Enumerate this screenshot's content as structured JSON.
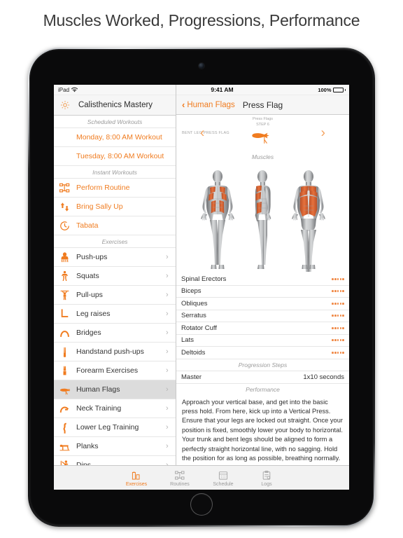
{
  "page": {
    "title": "Muscles Worked, Progressions, Performance"
  },
  "theme": {
    "accent": "#f07c20",
    "muscle_dot": "#f08a48",
    "selected_row_bg": "#dcdcdc"
  },
  "sidebar": {
    "status": {
      "device": "iPad",
      "wifi_icon": "wifi-icon"
    },
    "header": {
      "settings_icon": "gear-icon",
      "title": "Calisthenics Mastery"
    },
    "sections": [
      {
        "title": "Scheduled Workouts",
        "items": [
          {
            "label": "Monday, 8:00 AM Workout",
            "accent": true,
            "icon": null,
            "chevron": false
          },
          {
            "label": "Tuesday, 8:00 AM Workout",
            "accent": true,
            "icon": null,
            "chevron": false
          }
        ]
      },
      {
        "title": "Instant Workouts",
        "items": [
          {
            "label": "Perform Routine",
            "accent": true,
            "icon": "routine-icon",
            "chevron": false
          },
          {
            "label": "Bring Sally Up",
            "accent": true,
            "icon": "updown-arrows-icon",
            "chevron": false
          },
          {
            "label": "Tabata",
            "accent": true,
            "icon": "timer-icon",
            "chevron": false
          }
        ]
      },
      {
        "title": "Exercises",
        "items": [
          {
            "label": "Push-ups",
            "accent": false,
            "icon": "pushup-icon",
            "chevron": true,
            "selected": false
          },
          {
            "label": "Squats",
            "accent": false,
            "icon": "squat-icon",
            "chevron": true,
            "selected": false
          },
          {
            "label": "Pull-ups",
            "accent": false,
            "icon": "pullup-icon",
            "chevron": true,
            "selected": false
          },
          {
            "label": "Leg raises",
            "accent": false,
            "icon": "legraise-icon",
            "chevron": true,
            "selected": false
          },
          {
            "label": "Bridges",
            "accent": false,
            "icon": "bridge-icon",
            "chevron": true,
            "selected": false
          },
          {
            "label": "Handstand push-ups",
            "accent": false,
            "icon": "handstand-icon",
            "chevron": true,
            "selected": false
          },
          {
            "label": "Forearm Exercises",
            "accent": false,
            "icon": "forearm-icon",
            "chevron": true,
            "selected": false
          },
          {
            "label": "Human Flags",
            "accent": false,
            "icon": "humanflag-icon",
            "chevron": true,
            "selected": true
          },
          {
            "label": "Neck Training",
            "accent": false,
            "icon": "neck-icon",
            "chevron": true,
            "selected": false
          },
          {
            "label": "Lower Leg Training",
            "accent": false,
            "icon": "lowerleg-icon",
            "chevron": true,
            "selected": false
          },
          {
            "label": "Planks",
            "accent": false,
            "icon": "plank-icon",
            "chevron": true,
            "selected": false
          },
          {
            "label": "Dips",
            "accent": false,
            "icon": "dips-icon",
            "chevron": true,
            "selected": false
          }
        ]
      }
    ]
  },
  "detail": {
    "status": {
      "time": "9:41 AM",
      "battery_percent": "100%"
    },
    "navbar": {
      "back_label": "Human Flags",
      "title": "Press Flag"
    },
    "stepper": {
      "prev_label": "BENT LEG PRESS FLAG",
      "current_group": "Press Flags",
      "current_step": "STEP 6",
      "prev_arrow": "chevron-left-icon",
      "next_arrow": "chevron-right-icon"
    },
    "muscles_section": {
      "title": "Muscles"
    },
    "figures": [
      {
        "name": "anatomy-front"
      },
      {
        "name": "anatomy-side"
      },
      {
        "name": "anatomy-back"
      }
    ],
    "muscles": [
      {
        "name": "Spinal Erectors",
        "intensity": 5
      },
      {
        "name": "Biceps",
        "intensity": 5
      },
      {
        "name": "Obliques",
        "intensity": 5
      },
      {
        "name": "Serratus",
        "intensity": 5
      },
      {
        "name": "Rotator Cuff",
        "intensity": 5
      },
      {
        "name": "Lats",
        "intensity": 5
      },
      {
        "name": "Deltoids",
        "intensity": 5
      }
    ],
    "progression_section": {
      "title": "Progression Steps"
    },
    "progressions": [
      {
        "label": "Master",
        "value": "1x10 seconds"
      }
    ],
    "performance_section": {
      "title": "Performance"
    },
    "performance_text": "Approach your vertical base, and get into the basic press hold. From here, kick up into a Vertical Press. Ensure that your legs are locked out straight. Once your position is fixed, smoothly lower your body to horizontal. Your trunk and bent legs should be aligned to form a perfectly straight horizontal line, with no sagging. Hold the position for as long as possible, breathing normally."
  },
  "tabbar": {
    "tabs": [
      {
        "label": "Exercises",
        "icon": "chart-bars-icon",
        "active": true
      },
      {
        "label": "Routines",
        "icon": "nodes-icon",
        "active": false
      },
      {
        "label": "Schedule",
        "icon": "calendar-icon",
        "active": false
      },
      {
        "label": "Logs",
        "icon": "clipboard-icon",
        "active": false
      }
    ]
  }
}
